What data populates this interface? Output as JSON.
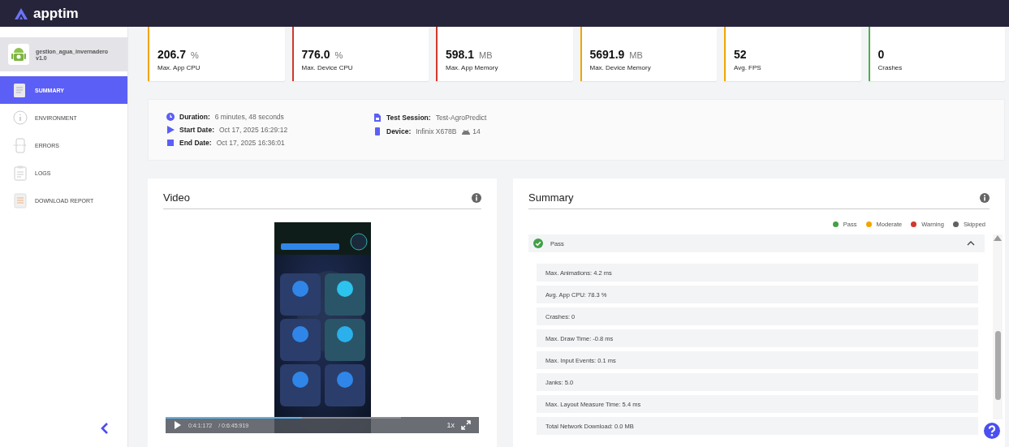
{
  "brand": {
    "name": "apptim"
  },
  "app": {
    "name": "gestion_agua_invernadero",
    "version": "v1.0"
  },
  "nav": [
    {
      "kind": "summary",
      "label": "SUMMARY",
      "selected": true
    },
    {
      "kind": "environment",
      "label": "ENVIRONMENT",
      "selected": false
    },
    {
      "kind": "errors",
      "label": "ERRORS",
      "selected": false
    },
    {
      "kind": "logs",
      "label": "LOGS",
      "selected": false
    },
    {
      "kind": "report",
      "label": "DOWNLOAD REPORT",
      "selected": false
    }
  ],
  "stats": [
    {
      "value": "206.7",
      "unit": "%",
      "label": "Max. App CPU",
      "color": "#f0a500"
    },
    {
      "value": "776.0",
      "unit": "%",
      "label": "Max. Device CPU",
      "color": "#d0392b"
    },
    {
      "value": "598.1",
      "unit": "MB",
      "label": "Max. App Memory",
      "color": "#d0392b"
    },
    {
      "value": "5691.9",
      "unit": "MB",
      "label": "Max. Device Memory",
      "color": "#f0a500"
    },
    {
      "value": "52",
      "label": "Avg. FPS",
      "color": "#f0a500"
    },
    {
      "value": "0",
      "label": "Crashes",
      "color": "#4caf50"
    }
  ],
  "info": {
    "left": [
      {
        "kind": "duration",
        "label": "Duration:",
        "value": "6 minutes, 48 seconds"
      },
      {
        "kind": "start",
        "label": "Start Date:",
        "value": "Oct 17, 2025 16:29:12"
      },
      {
        "kind": "end",
        "label": "End Date:",
        "value": "Oct 17, 2025 16:36:01"
      }
    ],
    "right": [
      {
        "kind": "session",
        "label": "Test Session:",
        "value": "Test-AgroPredict"
      },
      {
        "kind": "device",
        "label": "Device:",
        "value": "Infinix X678B",
        "os_version": "14"
      }
    ]
  },
  "video": {
    "title": "Video",
    "current_time": "0:4:1:172",
    "total_time": "/ 0:6:45:919",
    "speed": "1x",
    "level": 0.58
  },
  "summary": {
    "title": "Summary",
    "legend": [
      {
        "label": "Pass",
        "color": "#43a047"
      },
      {
        "label": "Moderate",
        "color": "#f0a500"
      },
      {
        "label": "Warning",
        "color": "#d0392b"
      },
      {
        "label": "Skipped",
        "color": "#616161"
      }
    ],
    "group": {
      "label": "Pass",
      "expanded": true
    },
    "items": [
      "Max. Animations: 4.2 ms",
      "Avg. App CPU: 78.3 %",
      "Crashes: 0",
      "Max. Draw Time: -0.8 ms",
      "Max. Input Events: 0.1 ms",
      "Janks: 5.0",
      "Max. Layout Measure Time: 5.4 ms",
      "Total Network Download: 0.0 MB"
    ]
  }
}
